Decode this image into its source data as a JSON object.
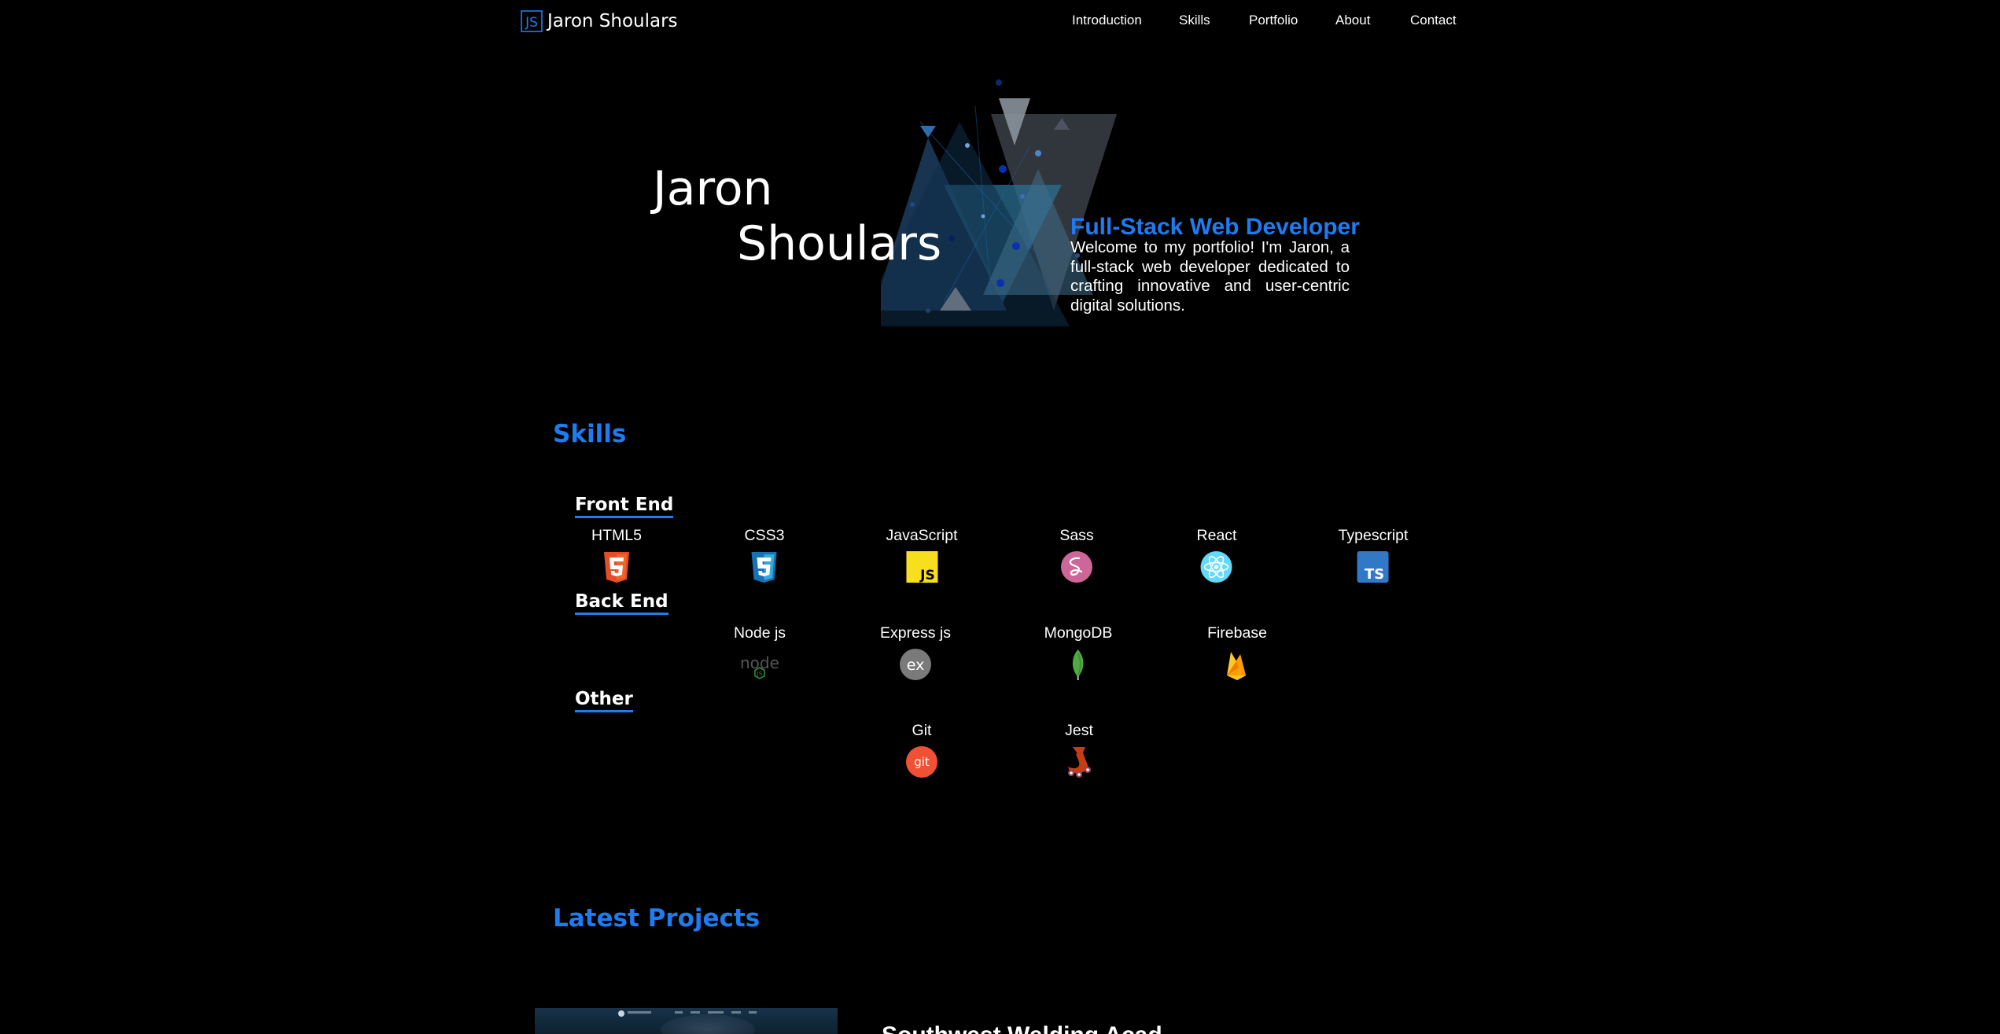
{
  "header": {
    "logo_text": "JS",
    "brand": "Jaron Shoulars",
    "nav": [
      "Introduction",
      "Skills",
      "Portfolio",
      "About",
      "Contact"
    ]
  },
  "hero": {
    "first_name": "Jaron",
    "last_name": "Shoulars",
    "role": "Full-Stack Web Developer",
    "intro": "Welcome to my portfolio! I'm Jaron, a full-stack web developer dedicated to crafting innovative and user-centric digital solutions."
  },
  "skills": {
    "title": "Skills",
    "categories": [
      {
        "title": "Front End",
        "items": [
          {
            "label": "HTML5",
            "icon": "html5-icon"
          },
          {
            "label": "CSS3",
            "icon": "css3-icon"
          },
          {
            "label": "JavaScript",
            "icon": "javascript-icon"
          },
          {
            "label": "Sass",
            "icon": "sass-icon"
          },
          {
            "label": "React",
            "icon": "react-icon"
          },
          {
            "label": "Typescript",
            "icon": "typescript-icon"
          }
        ]
      },
      {
        "title": "Back End",
        "items": [
          {
            "label": "Node js",
            "icon": "nodejs-icon"
          },
          {
            "label": "Express js",
            "icon": "express-icon"
          },
          {
            "label": "MongoDB",
            "icon": "mongodb-icon"
          },
          {
            "label": "Firebase",
            "icon": "firebase-icon"
          }
        ]
      },
      {
        "title": "Other",
        "items": [
          {
            "label": "Git",
            "icon": "git-icon"
          },
          {
            "label": "Jest",
            "icon": "jest-icon"
          }
        ]
      }
    ]
  },
  "projects": {
    "title": "Latest Projects",
    "items": [
      {
        "title": "Southwest Welding Acad"
      }
    ]
  },
  "colors": {
    "accent": "#1f7bf0",
    "background": "#000000",
    "html5": "#e44d26",
    "css3": "#1572b6",
    "javascript": "#f7df1e",
    "sass": "#cd6799",
    "react": "#61dafb",
    "typescript": "#3178c6",
    "mongodb": "#4faa41",
    "firebase": "#ffa611",
    "git": "#f05033",
    "jest": "#c63d14"
  }
}
